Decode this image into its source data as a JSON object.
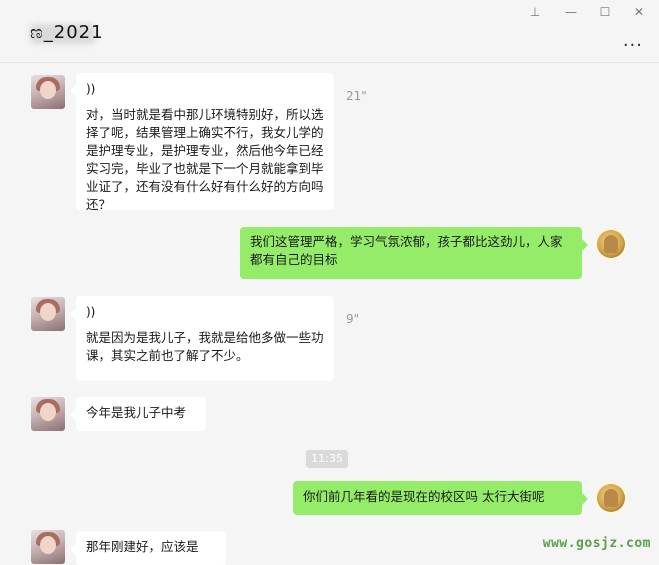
{
  "window": {
    "title": "ಣ_2021",
    "controls": [
      "pin-icon",
      "minimize-icon",
      "maximize-icon",
      "close-icon"
    ],
    "more_label": "..."
  },
  "messages": [
    {
      "side": "left",
      "voice_icon": "))",
      "duration": "21\"",
      "text": "对，当时就是看中那儿环境特别好，所以选择了呢，结果管理上确实不行，我女儿学的是护理专业，是护理专业，然后他今年已经实习完，毕业了也就是下一个月就能拿到毕业证了，还有没有什么好有什么好的方向吗还？"
    },
    {
      "side": "right",
      "text": "我们这管理严格，学习气氛浓郁，孩子都比这劲儿，人家都有自己的目标"
    },
    {
      "side": "left",
      "voice_icon": "))",
      "duration": "9\"",
      "text": "就是因为是我儿子，我就是给他多做一些功课，其实之前也了解了不少。"
    },
    {
      "side": "left",
      "text": "今年是我儿子中考"
    },
    {
      "timestamp": "11:35"
    },
    {
      "side": "right",
      "text": "你们前几年看的是现在的校区吗 太行大街呢"
    },
    {
      "side": "left",
      "text": "那年刚建好，应该是"
    }
  ],
  "watermark": "www.gosjz.com",
  "colors": {
    "green_bubble": "#95ec69",
    "background": "#f5f5f5",
    "white_bubble": "#ffffff"
  }
}
